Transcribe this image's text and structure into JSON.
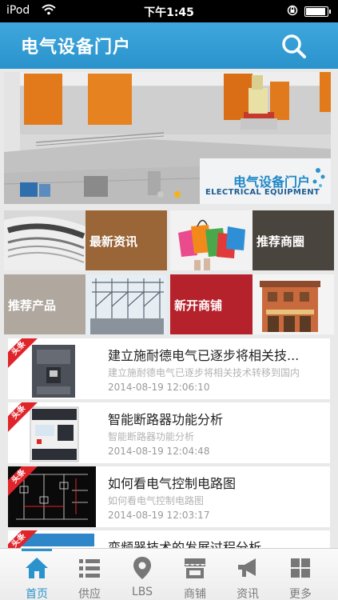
{
  "status_bar": {
    "carrier": "iPod",
    "time": "下午1:45",
    "battery_level": 0.95
  },
  "header": {
    "title": "电气设备门户",
    "search_icon": "search-icon"
  },
  "banner": {
    "caption_cn": "电气设备门户",
    "caption_en": "ELECTRICAL EQUIPMENT",
    "slides": 2,
    "active_slide": 2
  },
  "tiles": [
    {
      "label": "最新资讯",
      "color": "#9a6638"
    },
    {
      "label": "推荐商圈",
      "color": "#4a443e"
    },
    {
      "label": "推荐产品",
      "color": "#b0a89f"
    },
    {
      "label": "新开商铺",
      "color": "#b5222c"
    }
  ],
  "news": [
    {
      "badge": "头条",
      "title": "建立施耐德电气已逐步将相关技...",
      "summary": "建立施耐德电气已逐步将相关技术转移到国内",
      "date": "2014-08-19 12:06:10"
    },
    {
      "badge": "头条",
      "title": "智能断路器功能分析",
      "summary": "智能断路器功能分析",
      "date": "2014-08-19 12:04:48"
    },
    {
      "badge": "头条",
      "title": "如何看电气控制电路图",
      "summary": "如何看电气控制电路图",
      "date": "2014-08-19 12:03:17"
    },
    {
      "badge": "头条",
      "title": "变频器技术的发展过程分析",
      "summary": "",
      "date": ""
    }
  ],
  "tabbar": {
    "accent": "#2a93cc",
    "items": [
      {
        "label": "首页",
        "icon": "home-icon",
        "active": true
      },
      {
        "label": "供应",
        "icon": "list-icon",
        "active": false
      },
      {
        "label": "LBS",
        "icon": "location-pin-icon",
        "active": false
      },
      {
        "label": "商铺",
        "icon": "store-icon",
        "active": false
      },
      {
        "label": "资讯",
        "icon": "megaphone-icon",
        "active": false
      },
      {
        "label": "更多",
        "icon": "grid-icon",
        "active": false
      }
    ]
  }
}
